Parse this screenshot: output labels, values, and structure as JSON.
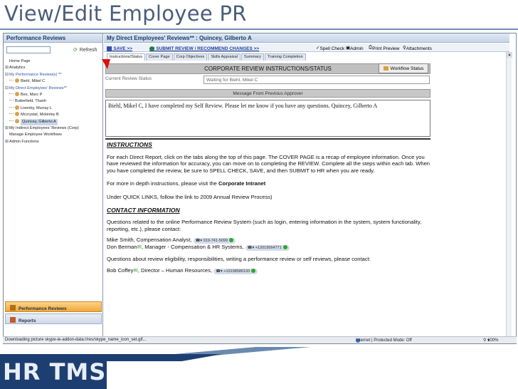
{
  "slide": {
    "title": "View/Edit Employee PR",
    "banner": "HR TMS"
  },
  "nav": {
    "header": "Performance Reviews",
    "search_placeholder": "",
    "refresh_label": "Refresh",
    "items": [
      {
        "label": "Home Page"
      },
      {
        "label": "Analytics"
      },
      {
        "label": "My Performance Review(s) **"
      },
      {
        "label": "Biehl, Mikel C"
      },
      {
        "label": "My Direct Employees' Reviews**"
      },
      {
        "label": "Bex, Marc P"
      },
      {
        "label": "Butterfield, Thanh"
      },
      {
        "label": "Lisenby, Murray L"
      },
      {
        "label": "Mccrystal, Mckinley B"
      },
      {
        "label": "Quincey, Gilberto A"
      },
      {
        "label": "My Indirect Employees' Reviews (Corp)"
      },
      {
        "label": "Manage Employee Workflows"
      },
      {
        "label": "Admin Functions"
      }
    ],
    "bottom_pr": "Performance Reviews",
    "bottom_reports": "Reports"
  },
  "main": {
    "header": "My Direct Employees' Reviews** : Quincey, Gilberto A",
    "toolbar": {
      "save": "<< SAVE >>",
      "submit": "<< SUBMIT REVIEW / RECOMMEND CHANGES >>",
      "spell_check": "Spell Check",
      "admin": "Admin",
      "print_preview": "Print Preview",
      "attachments": "Attachments"
    },
    "tabs": [
      {
        "label": "Instructions/Status"
      },
      {
        "label": "Cover Page"
      },
      {
        "label": "Corp Objectives"
      },
      {
        "label": "Skills Appraisal"
      },
      {
        "label": "Summary"
      },
      {
        "label": "Training Completion"
      }
    ],
    "status_heading": "CORPORATE REVIEW INSTRUCTIONS/STATUS",
    "workflow_button": "Workflow Status",
    "current_status_label": "Current Review Status",
    "current_status_value": "Waiting for Biehl, Mikel C",
    "message_heading": "Message From Previous Approver",
    "message_text": "Biehl, Mikel C, I have completed my Self Review. Please let me know if you have any questions. Quincey, Gilberto A",
    "instructions_heading": "INSTRUCTIONS",
    "instructions_p1": "For each Direct Report, click on the tabs along the top of this page. The COVER PAGE is a recap of employee information. Once you have reviewed the information for accuracy, you can move on to completing the REVIEW. Complete all the steps within each tab. When you have completed the review, be sure to SPELL CHECK, SAVE, and then SUBMIT to HR when you are ready.",
    "instructions_p2_prefix": "For more in depth instructions, please visit the ",
    "instructions_p2_link": "Corporate Intranet",
    "instructions_p3": "Under QUICK LINKS, follow the link to 2009 Annual Review Process)",
    "contact_heading": "CONTACT INFORMATION",
    "contact_p1": "Questions related to the online Performance Review System (such as login, entering information in the system, system functionality, reporting, etc.), please contact:",
    "contact1_name": "Mike Smith, Compensation Analyst,",
    "contact1_phone": "919-741-5099",
    "contact2_name": "Don Berman",
    "contact2_role": ", Manager - Compensation & HR Systems,",
    "contact2_phone": "+12019564771",
    "contact_p2": "Questions about review eligibility, responsibilities, writing a performance review or self reviews, please contact:",
    "contact3_name": "Bob Coffey",
    "contact3_role": ", Director – Human Resources,",
    "contact3_phone": "+19198586193"
  },
  "browser_status": {
    "left": "Downloading picture skype-ie-addon-data://res/skype_name_icon_set.gif...",
    "zone": "Internet | Protected Mode: Off",
    "zoom": "100%"
  }
}
